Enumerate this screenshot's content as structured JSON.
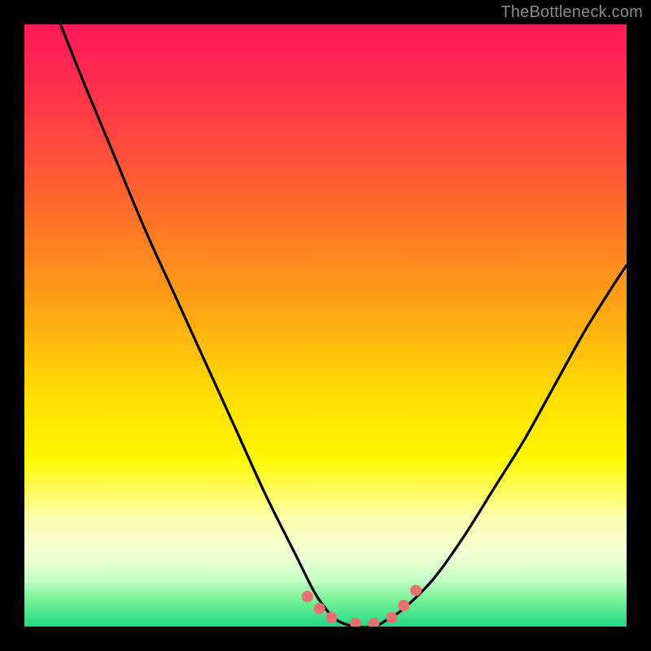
{
  "watermark": "TheBottleneck.com",
  "chart_data": {
    "type": "line",
    "title": "",
    "xlabel": "",
    "ylabel": "",
    "xlim": [
      0,
      100
    ],
    "ylim": [
      0,
      100
    ],
    "series": [
      {
        "name": "bottleneck-curve",
        "x": [
          6,
          10,
          15,
          20,
          25,
          30,
          35,
          40,
          45,
          48,
          50,
          52,
          55,
          58,
          60,
          63,
          68,
          73,
          78,
          83,
          88,
          93,
          98,
          100
        ],
        "values": [
          100,
          90,
          78,
          66,
          55,
          44,
          33,
          22,
          12,
          6,
          3,
          1,
          0,
          0,
          1,
          3,
          8,
          15,
          23,
          31,
          40,
          49,
          57,
          60
        ]
      }
    ],
    "markers": {
      "name": "highlight-dots",
      "color": "#e77070",
      "x": [
        47,
        49,
        51,
        55,
        58,
        61,
        63,
        65
      ],
      "values": [
        5,
        3,
        1.5,
        0.5,
        0.5,
        1.5,
        3.5,
        6
      ]
    },
    "background_gradient_stops": [
      {
        "pos": 0,
        "color": "#ff1a58"
      },
      {
        "pos": 20,
        "color": "#ff4a3e"
      },
      {
        "pos": 48,
        "color": "#ffa714"
      },
      {
        "pos": 72,
        "color": "#fff700"
      },
      {
        "pos": 88,
        "color": "#f1ffd4"
      },
      {
        "pos": 100,
        "color": "#22d785"
      }
    ]
  }
}
